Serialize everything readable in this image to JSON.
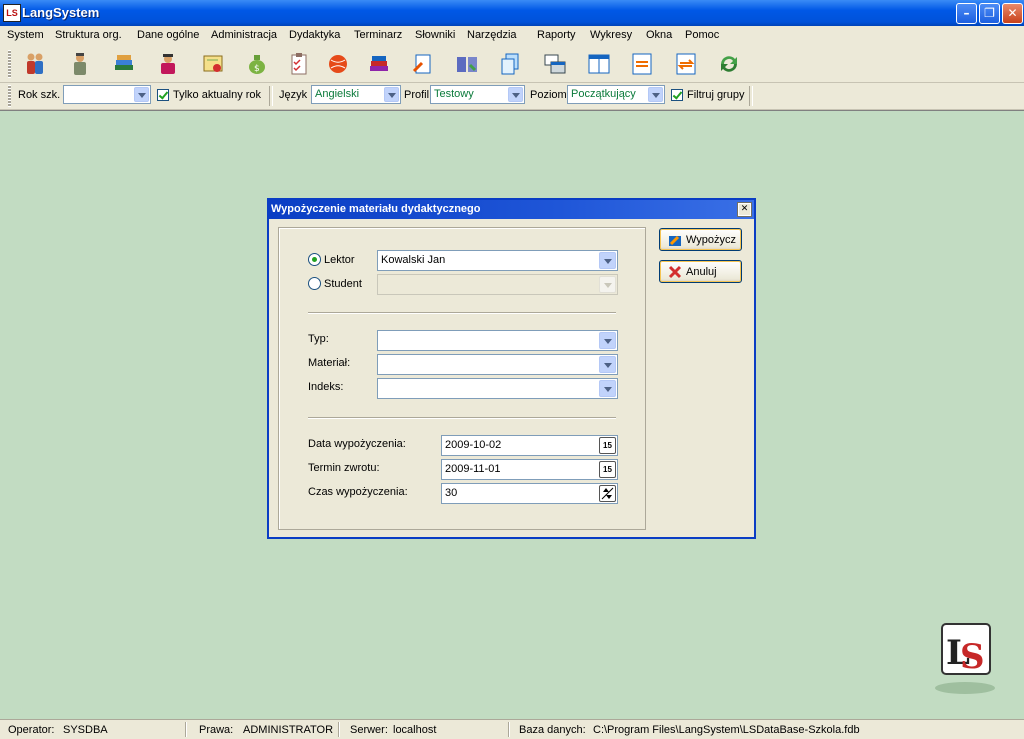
{
  "window": {
    "title": "LangSystem",
    "icon_text": "LS",
    "controls": {
      "minimize": "–",
      "maximize": "❐",
      "close": "✕"
    }
  },
  "menu": [
    "System",
    "Struktura org.",
    "Dane ogólne",
    "Administracja",
    "Dydaktyka",
    "Terminarz",
    "Słowniki",
    "Narzędzia",
    "Raporty",
    "Wykresy",
    "Okna",
    "Pomoc"
  ],
  "toolbar": {
    "icons": [
      "people-icon",
      "teacher-icon",
      "books-icon",
      "student-icon",
      "diploma-icon",
      "money-bag-icon",
      "checklist-icon",
      "ball-icon",
      "book-stack-icon",
      "document-arrow-icon",
      "book-open-icon",
      "pages-icon",
      "windows-icon",
      "columns-icon",
      "exchange-icon",
      "transfer-icon",
      "refresh-icon"
    ]
  },
  "filters": {
    "rok_label": "Rok szk.",
    "rok_value": "",
    "only_current_label": "Tylko aktualny rok",
    "only_current_checked": true,
    "jezyk_label": "Język",
    "jezyk_value": "Angielski",
    "profil_label": "Profil",
    "profil_value": "Testowy",
    "poziom_label": "Poziom",
    "poziom_value": "Początkujący",
    "filter_groups_label": "Filtruj grupy",
    "filter_groups_checked": true
  },
  "dialog": {
    "title": "Wypożyczenie materiału dydaktycznego",
    "close": "✕",
    "lektor_label": "Lektor",
    "lektor_value": "Kowalski Jan",
    "lektor_selected": true,
    "student_label": "Student",
    "student_value": "",
    "typ_label": "Typ:",
    "typ_value": "",
    "material_label": "Materiał:",
    "material_value": "",
    "indeks_label": "Indeks:",
    "indeks_value": "",
    "data_label": "Data wypożyczenia:",
    "data_value": "2009-10-02",
    "termin_label": "Termin zwrotu:",
    "termin_value": "2009-11-01",
    "czas_label": "Czas wypożyczenia:",
    "czas_value": "30",
    "calendar_glyph": "15",
    "borrow_button": "Wypożycz",
    "cancel_button": "Anuluj"
  },
  "status": {
    "operator_label": "Operator:",
    "operator_value": "SYSDBA",
    "prawa_label": "Prawa:",
    "prawa_value": "ADMINISTRATOR",
    "serwer_label": "Serwer:",
    "serwer_value": "localhost",
    "baza_label": "Baza danych:",
    "baza_value": "C:\\Program Files\\LangSystem\\LSDataBase-Szkola.fdb"
  },
  "colors": {
    "titlebar": "#0058e6",
    "workspace": "#c2dcc2",
    "dialog_border": "#0a3dc4",
    "combo_text": "#0a7a3a"
  }
}
